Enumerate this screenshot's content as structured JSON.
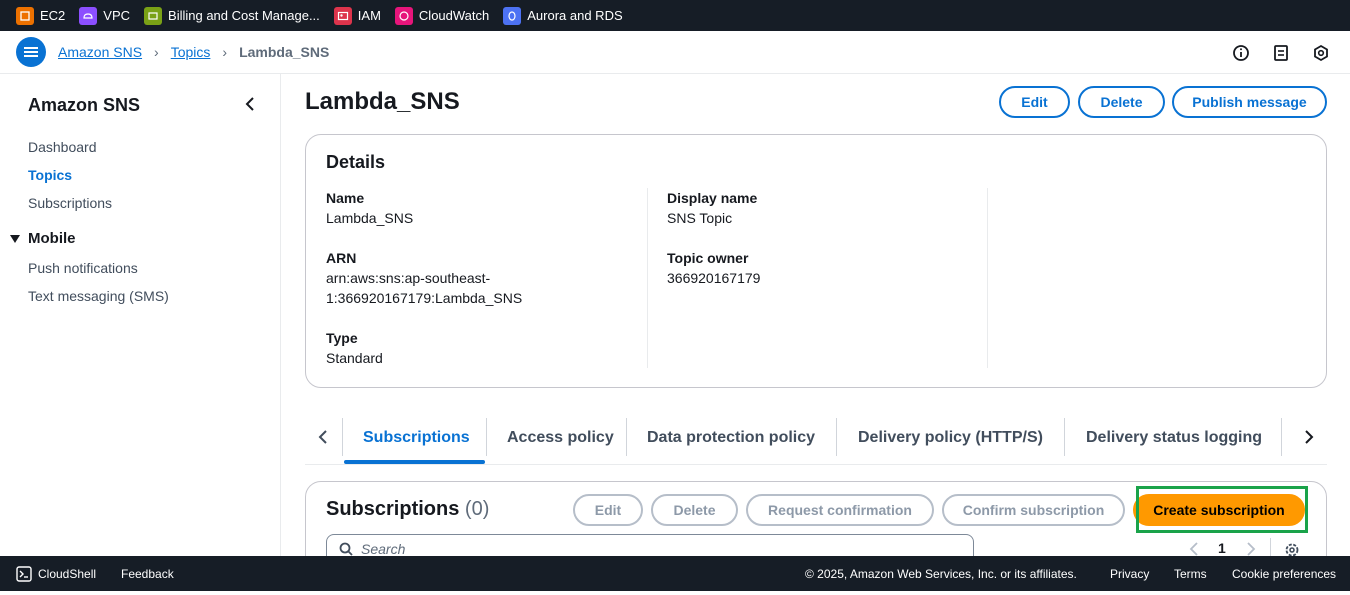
{
  "favorites": [
    {
      "label": "EC2",
      "color": "#ed7100"
    },
    {
      "label": "VPC",
      "color": "#8c4fff"
    },
    {
      "label": "Billing and Cost Manage...",
      "color": "#7aa116"
    },
    {
      "label": "IAM",
      "color": "#dd344c"
    },
    {
      "label": "CloudWatch",
      "color": "#e7157b"
    },
    {
      "label": "Aurora and RDS",
      "color": "#4d72f3"
    }
  ],
  "breadcrumb": {
    "items": [
      "Amazon SNS",
      "Topics"
    ],
    "current": "Lambda_SNS"
  },
  "sidebar": {
    "title": "Amazon SNS",
    "items": [
      "Dashboard",
      "Topics",
      "Subscriptions"
    ],
    "active": "Topics",
    "section": "Mobile",
    "section_items": [
      "Push notifications",
      "Text messaging (SMS)"
    ]
  },
  "page": {
    "title": "Lambda_SNS",
    "buttons": {
      "edit": "Edit",
      "delete": "Delete",
      "publish": "Publish message"
    }
  },
  "details": {
    "title": "Details",
    "name_label": "Name",
    "name_value": "Lambda_SNS",
    "arn_label": "ARN",
    "arn_value_line1": "arn:aws:sns:ap-southeast-",
    "arn_value_line2": "1:366920167179:Lambda_SNS",
    "type_label": "Type",
    "type_value": "Standard",
    "display_label": "Display name",
    "display_value": "SNS Topic",
    "owner_label": "Topic owner",
    "owner_value": "366920167179"
  },
  "tabs": [
    "Subscriptions",
    "Access policy",
    "Data protection policy",
    "Delivery policy (HTTP/S)",
    "Delivery status logging"
  ],
  "subscriptions": {
    "title": "Subscriptions",
    "count": "(0)",
    "buttons": {
      "edit": "Edit",
      "delete": "Delete",
      "request": "Request confirmation",
      "confirm": "Confirm subscription",
      "create": "Create subscription"
    },
    "search_placeholder": "Search",
    "page": "1"
  },
  "footer": {
    "cloudshell": "CloudShell",
    "feedback": "Feedback",
    "copyright": "© 2025, Amazon Web Services, Inc. or its affiliates.",
    "privacy": "Privacy",
    "terms": "Terms",
    "cookies": "Cookie preferences"
  }
}
